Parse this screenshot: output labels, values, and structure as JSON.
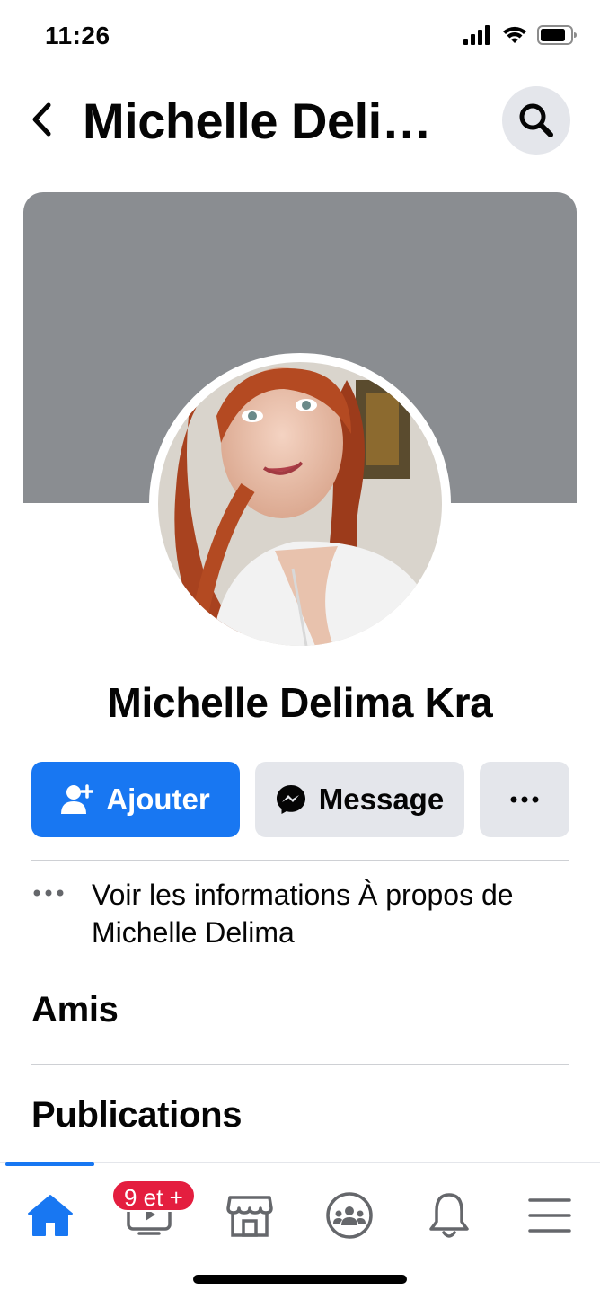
{
  "status_bar": {
    "time": "11:26"
  },
  "header": {
    "title": "Michelle Deli…"
  },
  "profile": {
    "name": "Michelle Delima Kra"
  },
  "actions": {
    "add_label": "Ajouter",
    "message_label": "Message"
  },
  "about": {
    "line1": "Voir les informations À propos de",
    "line2": "Michelle Delima"
  },
  "sections": {
    "friends": "Amis",
    "posts": "Publications"
  },
  "tabbar": {
    "active_tab": "home",
    "watch_badge": "9 et +"
  },
  "colors": {
    "accent": "#1877f2",
    "badge": "#e41e3f",
    "button_gray": "#e4e6eb",
    "cover_gray": "#8a8d91"
  },
  "icons": [
    "back-chevron-icon",
    "search-icon",
    "add-friend-icon",
    "messenger-icon",
    "more-icon",
    "home-icon",
    "watch-icon",
    "marketplace-icon",
    "groups-icon",
    "bell-icon",
    "menu-icon"
  ]
}
